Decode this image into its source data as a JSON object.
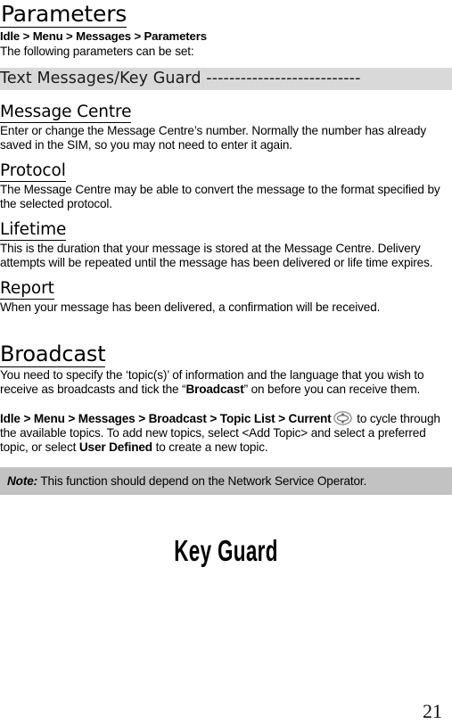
{
  "document": {
    "title": "Parameters",
    "breadcrumb": "Idle > Menu > Messages > Parameters",
    "intro": "The following parameters can be set:",
    "running_head": {
      "label": "Text Messages/Key Guard",
      "dashes": " ---------------------------",
      "background_color": "#d9d9d9"
    },
    "page_number": "21",
    "chapter_title": "Key Guard"
  },
  "sections": [
    {
      "heading": "Message Centre",
      "body": "Enter or change the Message Centre’s number. Normally the number has already saved in the SIM, so you may not need to enter it again."
    },
    {
      "heading": "Protocol",
      "body": "The Message Centre may be able to convert the message to the format specified by the selected protocol."
    },
    {
      "heading": "Lifetime",
      "body": "This is the duration that your message is stored at the Message Centre. Delivery attempts will be repeated until the message has been delivered or life time expires."
    },
    {
      "heading": "Report",
      "body": "When your message has been delivered, a confirmation will be received."
    }
  ],
  "broadcast": {
    "heading": "Broadcast",
    "intro_a": "You need to specify the ‘topic(s)’ of information and the language that you wish to receive as broadcasts and tick the “",
    "intro_bold": "Broadcast",
    "intro_b": "” on before you can receive them.",
    "path_bold": "Idle > Menu > Messages > Broadcast > Topic List > Current",
    "nav_icon": "navigation-key-icon",
    "after_icon": " to cycle through the available topics. To add new topics, select <Add Topic> and select a preferred topic, or select ",
    "user_defined_bold": "User  Defined",
    "tail": " to create a new topic."
  },
  "note": {
    "label": "Note:",
    "text": " This function should depend on the Network Service Operator.",
    "background_color": "#c2c2c2"
  }
}
